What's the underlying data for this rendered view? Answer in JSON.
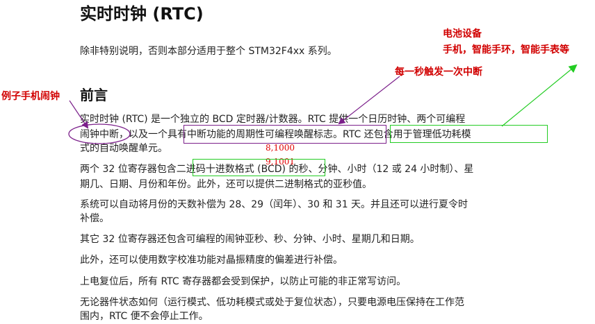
{
  "doc": {
    "title": "实时时钟 (RTC)",
    "scope": "除非特别说明，否则本部分适用于整个 STM32F4xx 系列。",
    "preface_heading": "前言",
    "p1": {
      "line1": "实时时钟 (RTC) 是一个独立的 BCD 定时器/计数器。RTC 提供一个日历时钟、两个可编程",
      "line2": "闹钟中断，以及一个具有中断功能的周期性可编程唤醒标志。RTC 还包含用于管理低功耗模",
      "line3": "式的自动唤醒单元。"
    },
    "p2": {
      "line1": "两个 32 位寄存器包含二进码十进数格式 (BCD) 的秒、分钟、小时（12 或 24 小时制）、星",
      "line2": "期几、日期、月份和年份。此外，还可以提供二进制格式的亚秒值。"
    },
    "p3": {
      "line1": "系统可以自动将月份的天数补偿为 28、29（闰年）、30 和 31 天。并且还可以进行夏令时",
      "line2": "补偿。"
    },
    "p4": "其它 32 位寄存器还包含可编程的闹钟亚秒、秒、分钟、小时、星期几和日期。",
    "p5": "此外，还可以使用数字校准功能对晶振精度的偏差进行补偿。",
    "p6": "上电复位后，所有 RTC 寄存器都会受到保护，以防止可能的非正常写访问。",
    "p7": {
      "line1": "无论器件状态如何（运行模式、低功耗模式或处于复位状态），只要电源电压保持在工作范",
      "line2": "围内，RTC 便不会停止工作。"
    }
  },
  "annotations": {
    "alarm_example": "例子手机闹钟",
    "battery_device_line1": "电池设备",
    "battery_device_line2": "手机，智能手环，智能手表等",
    "wakeup_note": "每一秒触发一次中断",
    "bcd_example_1": "8,1000",
    "bcd_example_2": "9,1001",
    "colors": {
      "red": "#d10000",
      "purple": "#7b1f8a",
      "green": "#22cc22"
    }
  }
}
